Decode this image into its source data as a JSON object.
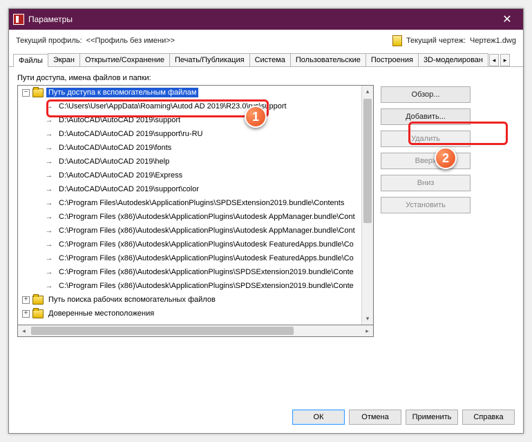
{
  "window": {
    "title": "Параметры"
  },
  "profile_row": {
    "current_profile_label": "Текущий профиль:",
    "current_profile_value": "<<Профиль без имени>>",
    "current_drawing_label": "Текущий чертеж:",
    "current_drawing_value": "Чертеж1.dwg"
  },
  "tabs": [
    "Файлы",
    "Экран",
    "Открытие/Сохранение",
    "Печать/Публикация",
    "Система",
    "Пользовательские",
    "Построения",
    "3D-моделирован"
  ],
  "tree": {
    "caption": "Пути доступа, имена файлов и папки:",
    "root_label": "Путь доступа к вспомогательным файлам",
    "paths": [
      "C:\\Users\\User\\AppData\\Roaming\\Autod             AD 2019\\R23.0\\rus\\support",
      "D:\\AutoCAD\\AutoCAD 2019\\support",
      "D:\\AutoCAD\\AutoCAD 2019\\support\\ru-RU",
      "D:\\AutoCAD\\AutoCAD 2019\\fonts",
      "D:\\AutoCAD\\AutoCAD 2019\\help",
      "D:\\AutoCAD\\AutoCAD 2019\\Express",
      "D:\\AutoCAD\\AutoCAD 2019\\support\\color",
      "C:\\Program Files\\Autodesk\\ApplicationPlugins\\SPDSExtension2019.bundle\\Contents",
      "C:\\Program Files (x86)\\Autodesk\\ApplicationPlugins\\Autodesk AppManager.bundle\\Cont",
      "C:\\Program Files (x86)\\Autodesk\\ApplicationPlugins\\Autodesk AppManager.bundle\\Cont",
      "C:\\Program Files (x86)\\Autodesk\\ApplicationPlugins\\Autodesk FeaturedApps.bundle\\Co",
      "C:\\Program Files (x86)\\Autodesk\\ApplicationPlugins\\Autodesk FeaturedApps.bundle\\Co",
      "C:\\Program Files (x86)\\Autodesk\\ApplicationPlugins\\SPDSExtension2019.bundle\\Conte",
      "C:\\Program Files (x86)\\Autodesk\\ApplicationPlugins\\SPDSExtension2019.bundle\\Conte"
    ],
    "siblings": [
      "Путь поиска рабочих вспомогательных файлов",
      "Доверенные местоположения"
    ]
  },
  "side_buttons": {
    "browse": "Обзор...",
    "add": "Добавить...",
    "delete": "Удалить",
    "up": "Вверх",
    "down": "Вниз",
    "set": "Установить"
  },
  "dialog_buttons": {
    "ok": "ОК",
    "cancel": "Отмена",
    "apply": "Применить",
    "help": "Справка"
  },
  "callouts": {
    "one": "1",
    "two": "2"
  }
}
